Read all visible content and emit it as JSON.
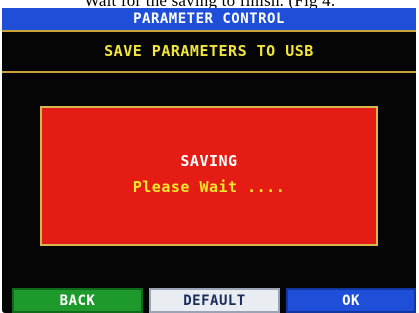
{
  "document_text": "Wait for the saving to finish. (Fig 4.",
  "screen": {
    "title": "PARAMETER CONTROL",
    "subtitle": "SAVE PARAMETERS TO USB"
  },
  "dialog": {
    "title": "SAVING",
    "message": "Please Wait ...."
  },
  "buttons": {
    "back_label": "BACK",
    "default_label": "DEFAULT",
    "ok_label": "OK"
  },
  "colors": {
    "title_bar": "#1f4fd8",
    "background": "#050505",
    "subtitle_text": "#f2e53a",
    "dialog_bg": "#e51c14",
    "dialog_message": "#f4ea2a",
    "back_button": "#1e9a2c",
    "default_button": "#e9edf2",
    "ok_button": "#1f4fd8"
  }
}
